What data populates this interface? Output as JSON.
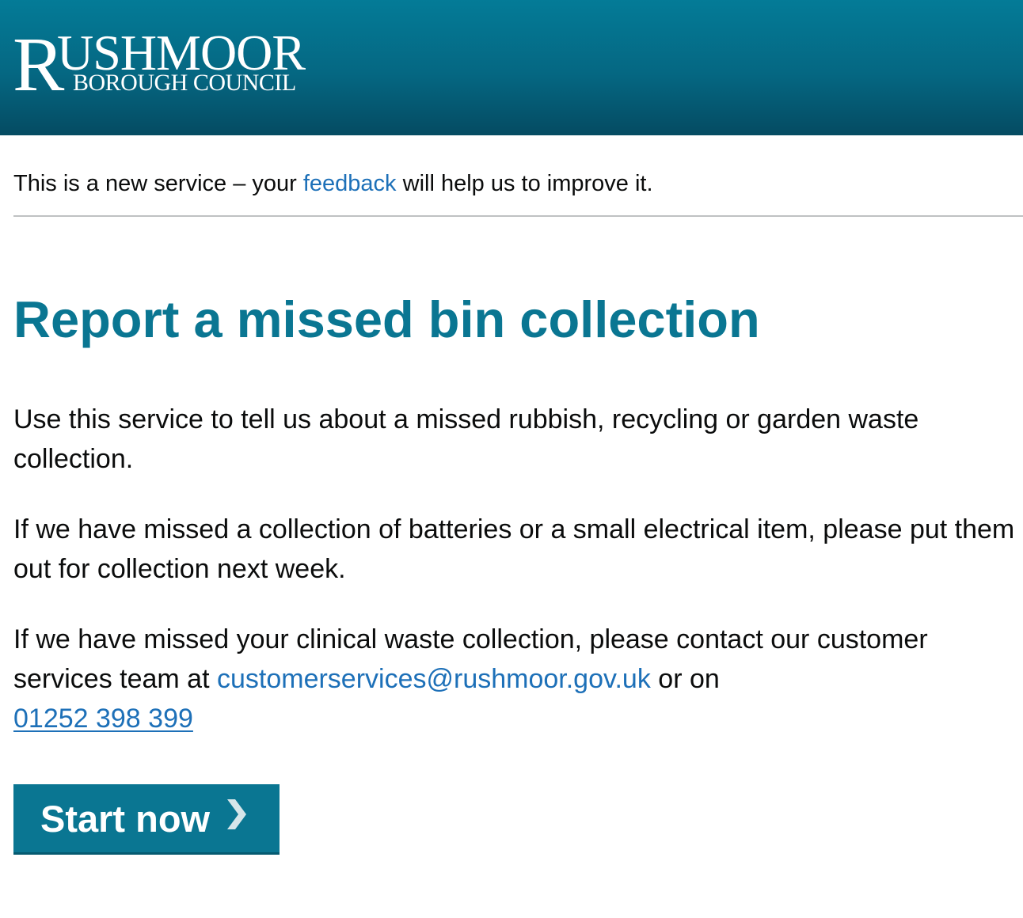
{
  "header": {
    "logo": {
      "initial": "R",
      "name_rest": "USHMOOR",
      "subtitle": "BOROUGH COUNCIL"
    }
  },
  "phase_banner": {
    "text_before": "This is a new service – your ",
    "link_label": "feedback",
    "text_after": " will help us to improve it."
  },
  "main": {
    "title": "Report a missed bin collection",
    "paragraph_1": "Use this service to tell us about a missed rubbish, recycling or garden waste collection.",
    "paragraph_2": "If we have missed a collection of batteries or a small electrical item, please put them out for collection next week.",
    "paragraph_3": {
      "text_before": "If we have missed your clinical waste collection, please contact our customer services team at ",
      "email": "customerservices@rushmoor.gov.uk",
      "text_middle": " or on ",
      "phone": "01252 398 399"
    },
    "start_button": {
      "label": "Start now",
      "icon": "chevron-right-icon"
    }
  },
  "colors": {
    "header_background": "#056782",
    "heading": "#0a7692",
    "link": "#1d70b8",
    "button": "#0a7692",
    "divider": "#bfc1c3"
  }
}
